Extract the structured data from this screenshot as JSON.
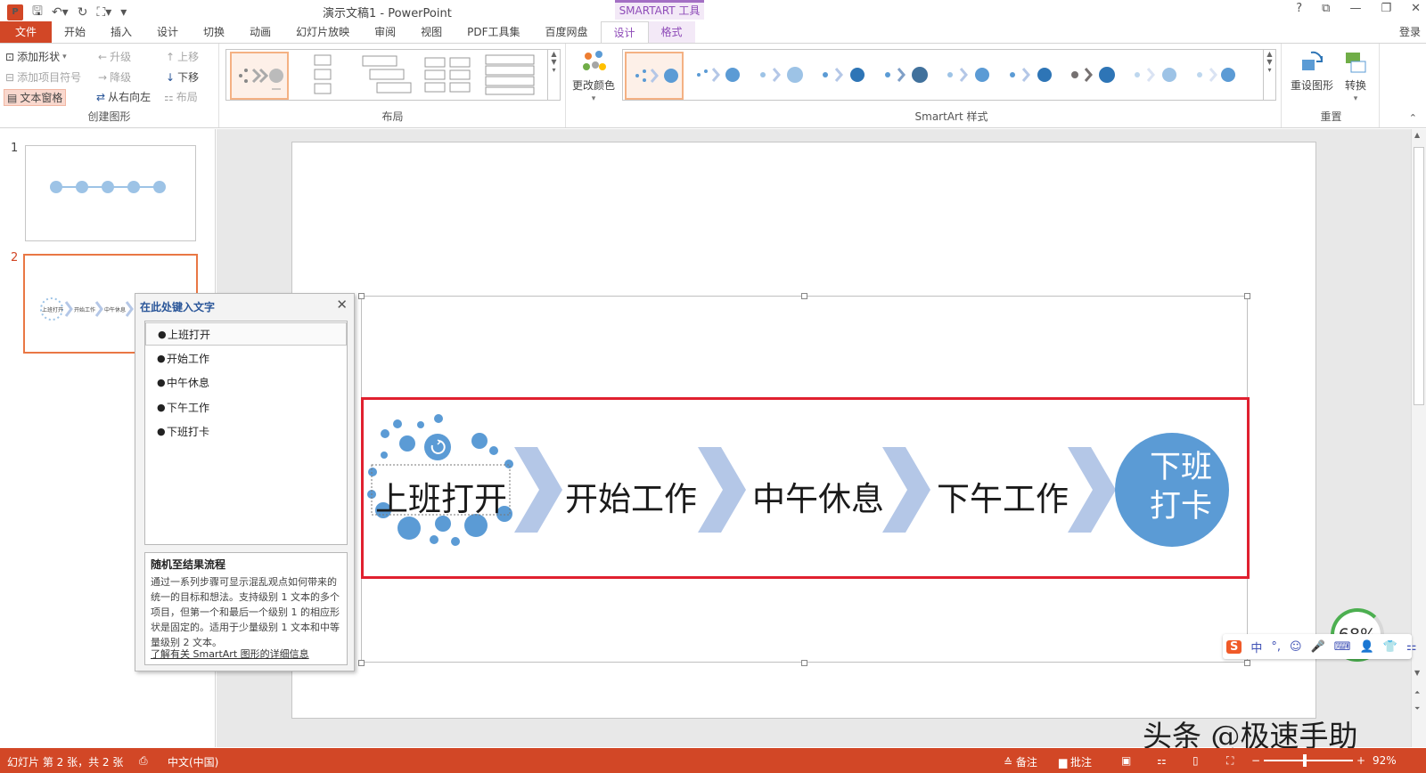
{
  "window": {
    "title": "演示文稿1 - PowerPoint",
    "context_tab_header": "SMARTART 工具",
    "login": "登录",
    "controls": [
      "?",
      "⧉",
      "—",
      "❐",
      "✕"
    ]
  },
  "qat": {
    "app_icon": "P",
    "icons": [
      "save-icon",
      "undo-icon",
      "redo-icon",
      "present-icon",
      "customize-icon"
    ]
  },
  "tabs": [
    "文件",
    "开始",
    "插入",
    "设计",
    "切换",
    "动画",
    "幻灯片放映",
    "审阅",
    "视图",
    "PDF工具集",
    "百度网盘",
    "设计",
    "格式"
  ],
  "ribbon": {
    "create_group": {
      "label": "创建图形",
      "add_shape": "添加形状",
      "add_bullet": "添加项目符号",
      "text_pane": "文本窗格",
      "promote": "升级",
      "demote": "降级",
      "right_to_left": "从右向左",
      "move_up": "上移",
      "move_down": "下移",
      "layout_btn": "布局"
    },
    "layout_group": {
      "label": "布局"
    },
    "change_colors": "更改颜色",
    "styles_group": {
      "label": "SmartArt 样式"
    },
    "reset_group": {
      "label": "重置",
      "reset_graphic": "重设图形",
      "convert": "转换"
    }
  },
  "slides": [
    {
      "number": "1"
    },
    {
      "number": "2",
      "mini_labels": [
        "上班打开",
        "开始工作",
        "中午休息"
      ]
    }
  ],
  "smartart": {
    "items": [
      "上班打开",
      "开始工作",
      "中午休息",
      "下午工作",
      "下班打卡"
    ],
    "last_line1": "下班",
    "last_line2": "打卡"
  },
  "text_pane": {
    "title": "在此处键入文字",
    "items": [
      "上班打开",
      "开始工作",
      "中午休息",
      "下午工作",
      "下班打卡"
    ],
    "desc_title": "随机至结果流程",
    "desc_body": "通过一系列步骤可显示混乱观点如何带来的统一的目标和想法。支持级别 1 文本的多个项目，但第一个和最后一个级别 1 的相应形状是固定的。适用于少量级别 1 文本和中等量级别 2 文本。",
    "link": "了解有关 SmartArt 图形的详细信息"
  },
  "ime": {
    "items": [
      "中",
      "°,",
      "☺",
      "🎤",
      "⌨",
      "👤",
      "👕",
      "⚏"
    ]
  },
  "gauge": {
    "value": "68%"
  },
  "watermark": "头条 @极速手助",
  "status": {
    "slide": "幻灯片 第 2 张，共 2 张",
    "lang": "中文(中国)",
    "notes": "备注",
    "comments": "批注",
    "zoom": "92%"
  },
  "colors": {
    "accent": "#d24726",
    "smartart_blue": "#5b9bd5",
    "chevron": "#b4c7e7",
    "highlight_red": "#e0202f"
  }
}
